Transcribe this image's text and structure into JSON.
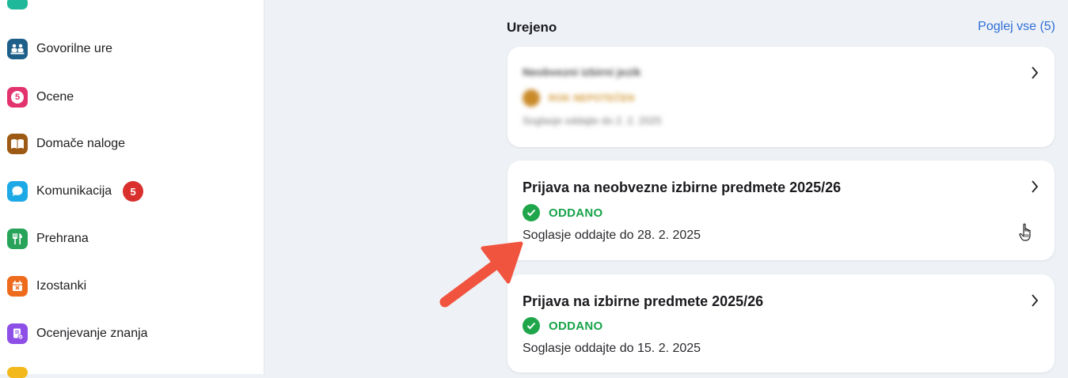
{
  "sidebar": {
    "items": [
      {
        "name": "govorilne-ure",
        "label": "Govorilne ure",
        "color": "#1e5f8a",
        "icon": "people-icon"
      },
      {
        "name": "ocene",
        "label": "Ocene",
        "color": "#e2336f",
        "icon": "grade-icon",
        "glyph": "5"
      },
      {
        "name": "domace-naloge",
        "label": "Domače naloge",
        "color": "#9c5a14",
        "icon": "book-icon"
      },
      {
        "name": "komunikacija",
        "label": "Komunikacija",
        "color": "#1da9e6",
        "icon": "chat-icon",
        "badge": "5"
      },
      {
        "name": "prehrana",
        "label": "Prehrana",
        "color": "#27a45a",
        "icon": "cutlery-icon"
      },
      {
        "name": "izostanki",
        "label": "Izostanki",
        "color": "#ee6b1e",
        "icon": "calendar-x-icon"
      },
      {
        "name": "ocenjevanje-znanja",
        "label": "Ocenjevanje znanja",
        "color": "#8e4fe6",
        "icon": "test-icon"
      }
    ]
  },
  "section": {
    "title": "Urejeno",
    "view_all": "Poglej vse (5)"
  },
  "cards": [
    {
      "title": "Neobvezni izbirni jezik",
      "status": "ROK NEPOTEČEN",
      "deadline": "Soglasje oddajte do 2. 2. 2025",
      "blurred": true
    },
    {
      "title": "Prijava na neobvezne izbirne predmete 2025/26",
      "status": "ODDANO",
      "deadline": "Soglasje oddajte do 28. 2. 2025"
    },
    {
      "title": "Prijava na izbirne predmete 2025/26",
      "status": "ODDANO",
      "deadline": "Soglasje oddajte do 15. 2. 2025"
    }
  ],
  "colors": {
    "status_green": "#17a34a",
    "link_blue": "#2f6fd8",
    "annotation_arrow": "#f0543f",
    "badge_red": "#d9302e"
  }
}
